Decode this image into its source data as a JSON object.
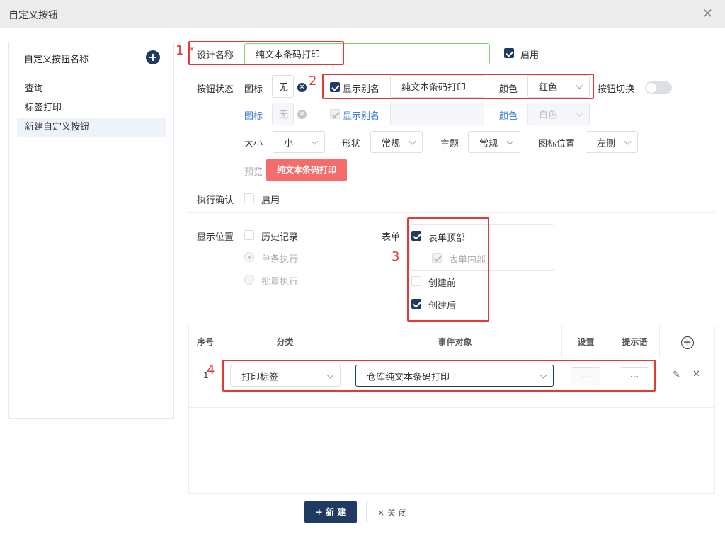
{
  "window": {
    "title": "自定义按钮"
  },
  "sidebar": {
    "title": "自定义按钮名称",
    "items": [
      {
        "label": "查询"
      },
      {
        "label": "标签打印"
      },
      {
        "label": "新建自定义按钮"
      }
    ]
  },
  "form": {
    "design_name_label": "设计名称",
    "required_mark": "*",
    "design_name_value": "纯文本条码打印",
    "enable_label": "启用",
    "enable_checked": true,
    "button_state_label": "按钮状态",
    "row1": {
      "icon_label": "图标",
      "icon_value": "无",
      "show_alias_label": "显示别名",
      "show_alias_checked": true,
      "alias_value": "纯文本条码打印",
      "color_label": "颜色",
      "color_value": "红色"
    },
    "toggle_label": "按钮切换",
    "toggle_on": false,
    "row2": {
      "icon_label": "图标",
      "icon_value": "无",
      "show_alias_label": "显示别名",
      "alias_value": "",
      "color_label": "颜色",
      "color_value": "白色"
    },
    "size_label": "大小",
    "size_value": "小",
    "shape_label": "形状",
    "shape_value": "常规",
    "theme_label": "主题",
    "theme_value": "常规",
    "icon_pos_label": "图标位置",
    "icon_pos_value": "左侧",
    "preview_label": "预览",
    "preview_button_text": "纯文本条码打印",
    "confirm_label": "执行确认",
    "confirm_option": "启用",
    "display_pos_label": "显示位置",
    "history_label": "历史记录",
    "single_exec_label": "单条执行",
    "batch_exec_label": "批量执行",
    "form_label": "表单",
    "form_options": [
      {
        "label": "表单顶部",
        "state": "checked"
      },
      {
        "label": "表单内部",
        "state": "disabled-checked"
      },
      {
        "label": "创建前",
        "state": "unchecked"
      },
      {
        "label": "创建后",
        "state": "checked"
      }
    ]
  },
  "annotations": [
    "1",
    "2",
    "3",
    "4"
  ],
  "table": {
    "headers": [
      "序号",
      "分类",
      "事件对象",
      "设置",
      "提示语"
    ],
    "rows": [
      {
        "index": "1",
        "category": "打印标签",
        "event_object": "仓库纯文本条码打印",
        "settings": "...",
        "hint": "..."
      }
    ]
  },
  "footer": {
    "new_label": "+ 新 建",
    "close_label": "× 关 闭"
  },
  "colors": {
    "primary": "#1f3b63",
    "annotation_red": "#e53935",
    "preview_red": "#f56c6c",
    "link_blue": "#3d7ed8"
  }
}
